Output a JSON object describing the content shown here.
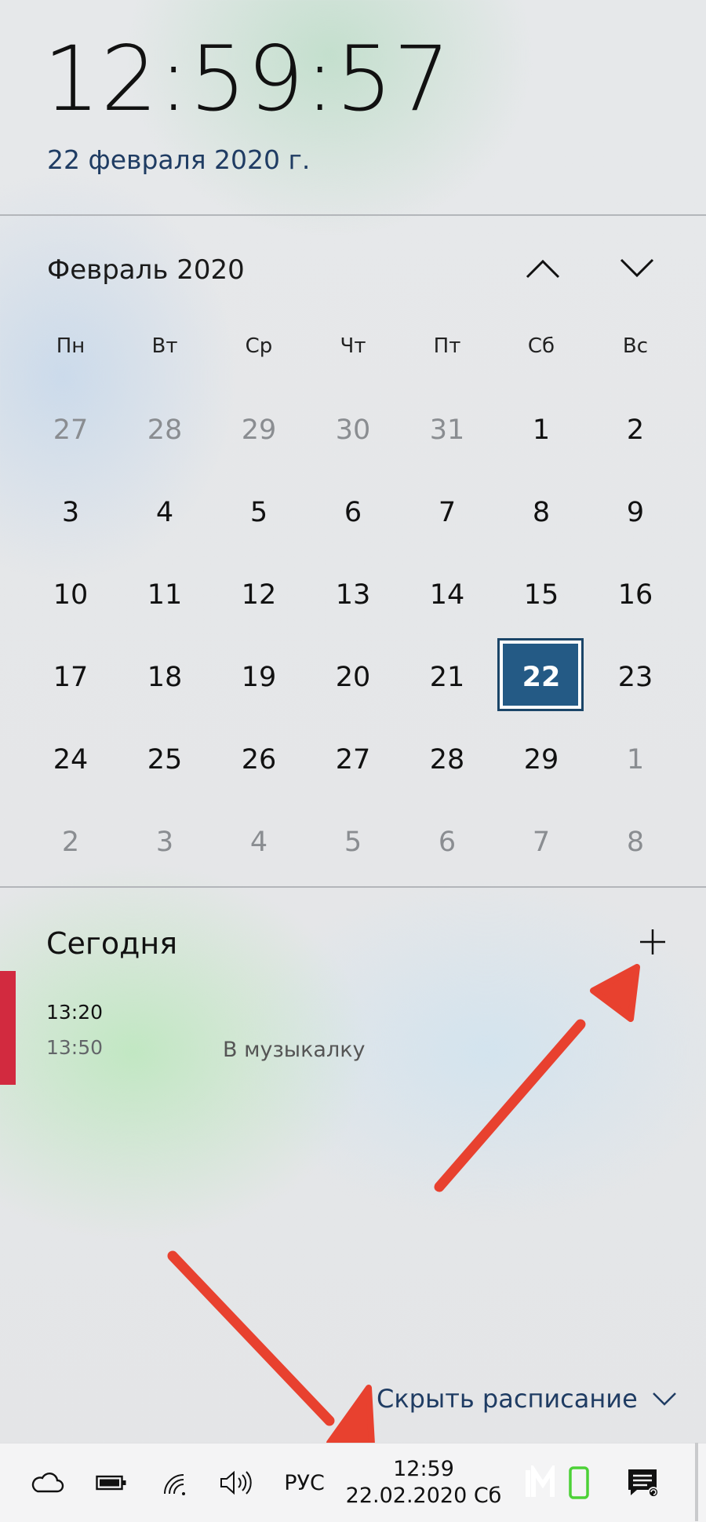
{
  "clock": {
    "time": "12:59:57",
    "date_long": "22 февраля 2020 г."
  },
  "calendar": {
    "month_title": "Февраль 2020",
    "prev_icon": "chevron-up-icon",
    "next_icon": "chevron-down-icon",
    "weekdays": [
      "Пн",
      "Вт",
      "Ср",
      "Чт",
      "Пт",
      "Сб",
      "Вс"
    ],
    "days": [
      {
        "label": "27",
        "state": "muted"
      },
      {
        "label": "28",
        "state": "muted"
      },
      {
        "label": "29",
        "state": "muted"
      },
      {
        "label": "30",
        "state": "muted"
      },
      {
        "label": "31",
        "state": "muted"
      },
      {
        "label": "1",
        "state": "current"
      },
      {
        "label": "2",
        "state": "current"
      },
      {
        "label": "3",
        "state": "current"
      },
      {
        "label": "4",
        "state": "current"
      },
      {
        "label": "5",
        "state": "current"
      },
      {
        "label": "6",
        "state": "current"
      },
      {
        "label": "7",
        "state": "current"
      },
      {
        "label": "8",
        "state": "current"
      },
      {
        "label": "9",
        "state": "current"
      },
      {
        "label": "10",
        "state": "current"
      },
      {
        "label": "11",
        "state": "current"
      },
      {
        "label": "12",
        "state": "current"
      },
      {
        "label": "13",
        "state": "current"
      },
      {
        "label": "14",
        "state": "current"
      },
      {
        "label": "15",
        "state": "current"
      },
      {
        "label": "16",
        "state": "current"
      },
      {
        "label": "17",
        "state": "current"
      },
      {
        "label": "18",
        "state": "current"
      },
      {
        "label": "19",
        "state": "current"
      },
      {
        "label": "20",
        "state": "current"
      },
      {
        "label": "21",
        "state": "current"
      },
      {
        "label": "22",
        "state": "today"
      },
      {
        "label": "23",
        "state": "current"
      },
      {
        "label": "24",
        "state": "current"
      },
      {
        "label": "25",
        "state": "current"
      },
      {
        "label": "26",
        "state": "current"
      },
      {
        "label": "27",
        "state": "current"
      },
      {
        "label": "28",
        "state": "current"
      },
      {
        "label": "29",
        "state": "current"
      },
      {
        "label": "1",
        "state": "muted"
      },
      {
        "label": "2",
        "state": "muted"
      },
      {
        "label": "3",
        "state": "muted"
      },
      {
        "label": "4",
        "state": "muted"
      },
      {
        "label": "5",
        "state": "muted"
      },
      {
        "label": "6",
        "state": "muted"
      },
      {
        "label": "7",
        "state": "muted"
      },
      {
        "label": "8",
        "state": "muted"
      }
    ]
  },
  "agenda": {
    "title": "Сегодня",
    "add_icon": "plus-icon",
    "events": [
      {
        "start": "13:20",
        "end": "13:50",
        "title": "В музыкалку",
        "color": "#d22a3f"
      }
    ],
    "hide_label": "Скрыть расписание"
  },
  "taskbar": {
    "icons": [
      "onedrive-cloud-icon",
      "battery-icon",
      "wifi-icon",
      "volume-icon"
    ],
    "lang": "РУС",
    "time": "12:59",
    "date": "22.02.2020 Сб",
    "tray_icons": [
      "im-logo-icon",
      "phone-icon",
      "action-center-icon"
    ]
  },
  "colors": {
    "accent": "#245a85",
    "date_text": "#1f3c63",
    "event_bar": "#d22a3f",
    "annotation_arrow": "#e8412f"
  }
}
